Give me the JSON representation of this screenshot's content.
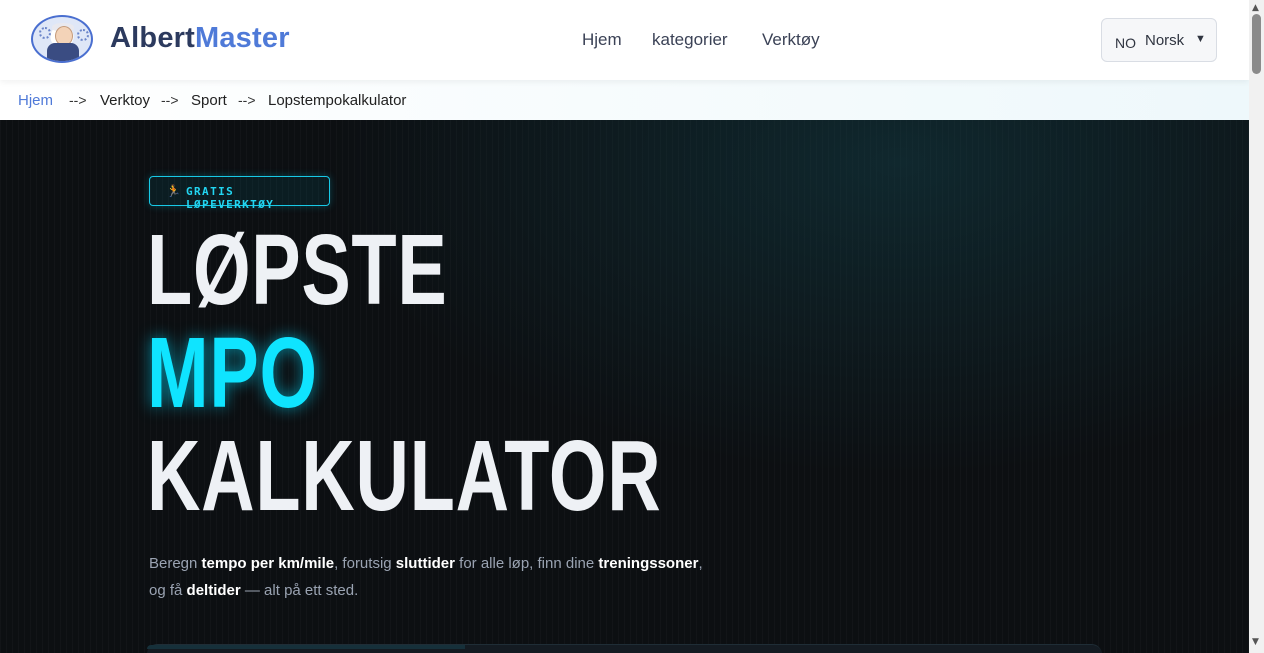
{
  "header": {
    "brand_part1": "Albert",
    "brand_part2": "Master",
    "nav": {
      "home": "Hjem",
      "categories": "kategorier",
      "tools": "Verktøy"
    },
    "language": {
      "code": "NO",
      "name": "Norsk",
      "arrow": "▼"
    }
  },
  "breadcrumb": {
    "items": [
      "Hjem",
      "Verktoy",
      "Sport",
      "Lopstempokalkulator"
    ],
    "separator": "-->"
  },
  "hero": {
    "badge_icon": "🏃",
    "badge_text": "GRATIS LØPEVERKTØY",
    "title_line1": "LØPSTE",
    "title_line2": "MPO",
    "title_line3": "KALKULATOR",
    "desc": {
      "p1": "Beregn ",
      "b1": "tempo per km/mile",
      "p2": ", forutsig ",
      "b2": "sluttider",
      "p3": " for alle løp, finn dine ",
      "b3": "treningssoner",
      "p4": ",",
      "p5": "og få ",
      "b4": "deltider",
      "p6": " — alt på ett sted."
    }
  },
  "colors": {
    "accent_cyan": "#0fe4ff",
    "brand_dark": "#2c3a5e",
    "brand_blue": "#4f7ad8",
    "hero_bg": "#0c0f12"
  },
  "icons": {
    "logo": "albert-avatar-logo",
    "badge": "runner-icon",
    "language_dropdown": "chevron-down-icon"
  }
}
